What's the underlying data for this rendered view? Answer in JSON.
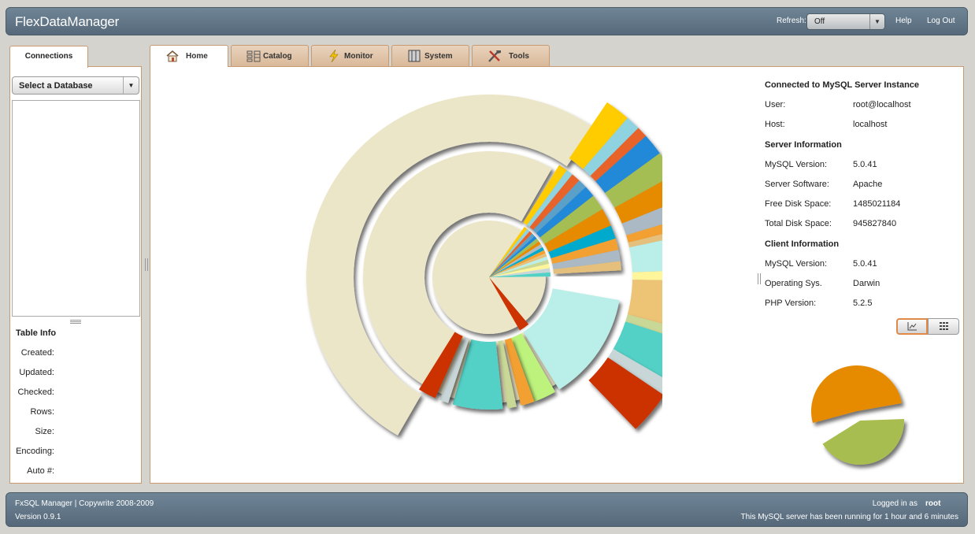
{
  "app": {
    "title": "FlexDataManager"
  },
  "topbar": {
    "refresh_label": "Refresh:",
    "refresh_value": "Off",
    "help": "Help",
    "logout": "Log Out"
  },
  "left": {
    "tab": "Connections",
    "db_select": "Select a Database",
    "table_info_title": "Table Info",
    "fields": [
      "Created:",
      "Updated:",
      "Checked:",
      "Rows:",
      "Size:",
      "Encoding:",
      "Auto #:"
    ]
  },
  "tabs": [
    {
      "label": "Home",
      "icon": "house-icon"
    },
    {
      "label": "Catalog",
      "icon": "catalog-icon"
    },
    {
      "label": "Monitor",
      "icon": "lightning-icon"
    },
    {
      "label": "System",
      "icon": "server-icon"
    },
    {
      "label": "Tools",
      "icon": "tools-icon"
    }
  ],
  "info": {
    "connected_title": "Connected to MySQL Server Instance",
    "user_label": "User:",
    "user_value": "root@localhost",
    "host_label": "Host:",
    "host_value": "localhost",
    "server_title": "Server Information",
    "mysql_label": "MySQL Version:",
    "mysql_value": "5.0.41",
    "software_label": "Server Software:",
    "software_value": "Apache",
    "free_label": "Free Disk Space:",
    "free_value": "1485021184",
    "total_label": "Total Disk Space:",
    "total_value": "945827840",
    "client_title": "Client Information",
    "client_mysql_label": "MySQL Version:",
    "client_mysql_value": "5.0.41",
    "os_label": "Operating Sys.",
    "os_value": "Darwin",
    "php_label": "PHP Version:",
    "php_value": "5.2.5"
  },
  "view_toggle": {
    "selected": "chart-view",
    "options": [
      "chart-view-icon",
      "grid-view-icon"
    ]
  },
  "colors": {
    "header": "#5f7384",
    "tab_border": "#c79a72",
    "ring_base": "#ece6c8",
    "orange": "#e68a00",
    "green": "#a7bd4f",
    "red": "#cc3300",
    "teal": "#52d1c6"
  },
  "footer": {
    "left_line1": "FxSQL Manager | Copywrite 2008-2009",
    "left_line2": "Version 0.9.1",
    "logged_in": "Logged in as",
    "user": "root",
    "uptime": "This MySQL server has been running for 1 hour and 6 minutes"
  }
}
